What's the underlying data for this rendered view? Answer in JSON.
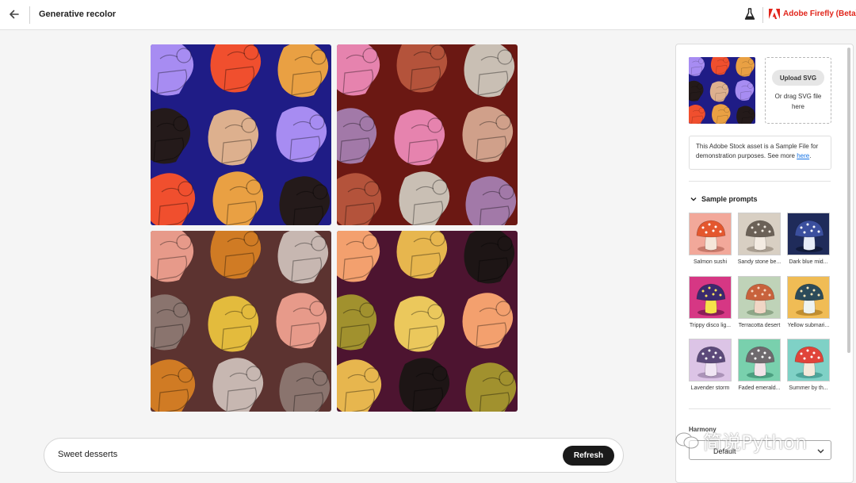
{
  "header": {
    "title": "Generative recolor",
    "back_icon": "arrow-left-icon",
    "labs_icon": "flask-icon",
    "brand_name": "Adobe Firefly (Beta)",
    "brand_color": "#e1251b"
  },
  "tiles": [
    {
      "bg": "#1f1c86",
      "colors": [
        "#a78cf2",
        "#f04f2e",
        "#e9a043",
        "#241a1a",
        "#ddb08e",
        "#a78cf2",
        "#f04f2e",
        "#e9a043",
        "#241a1a"
      ]
    },
    {
      "bg": "#6b1813",
      "colors": [
        "#e683ae",
        "#b4533b",
        "#c9bfb4",
        "#a279a8",
        "#e683ae",
        "#d0a08a",
        "#b4533b",
        "#c9bfb4",
        "#a279a8"
      ]
    },
    {
      "bg": "#5c3330",
      "colors": [
        "#e79a8a",
        "#d07b24",
        "#c7b7b1",
        "#8a746e",
        "#e3bb3d",
        "#e79a8a",
        "#d07b24",
        "#c7b7b1",
        "#8a746e"
      ]
    },
    {
      "bg": "#4d1430",
      "colors": [
        "#f3a06e",
        "#e7b64e",
        "#1d1515",
        "#a1912e",
        "#ebc85c",
        "#f3a06e",
        "#e7b64e",
        "#1d1515",
        "#a1912e"
      ]
    }
  ],
  "prompt": {
    "value": "Sweet desserts",
    "refresh_label": "Refresh"
  },
  "panel": {
    "upload_button": "Upload SVG",
    "upload_hint": "Or drag SVG file here",
    "notice_text": "This Adobe Stock asset is a Sample File for demonstration purposes. See more ",
    "notice_link": "here",
    "notice_end": ".",
    "samples_title": "Sample prompts",
    "samples": [
      {
        "label": "Salmon sushi",
        "bg": "#f2a89a",
        "cap": "#e4572e",
        "spots": "#ffffff",
        "stem": "#f5e6da",
        "shadow": "#c7796b"
      },
      {
        "label": "Sandy stone be...",
        "bg": "#d8cfc3",
        "cap": "#6b6157",
        "spots": "#efe8df",
        "stem": "#f3ebe2",
        "shadow": "#a89d90"
      },
      {
        "label": "Dark blue mid...",
        "bg": "#1f2b5a",
        "cap": "#3b4f9e",
        "spots": "#ffffff",
        "stem": "#e7ecf7",
        "shadow": "#111a3a"
      },
      {
        "label": "Trippy disco lig...",
        "bg": "#d63784",
        "cap": "#3a2a6e",
        "spots": "#ffe35a",
        "stem": "#f6e24a",
        "shadow": "#8a1f58"
      },
      {
        "label": "Terracotta desert",
        "bg": "#bfd3b8",
        "cap": "#c8623c",
        "spots": "#f5d7c2",
        "stem": "#f0d6c5",
        "shadow": "#8ea788"
      },
      {
        "label": "Yellow submari...",
        "bg": "#f0bc55",
        "cap": "#2c4b5a",
        "spots": "#f6e6b8",
        "stem": "#eef3f0",
        "shadow": "#c18e2f"
      },
      {
        "label": "Lavender storm",
        "bg": "#dcc4e6",
        "cap": "#5c4a7a",
        "spots": "#ffffff",
        "stem": "#f1e6f4",
        "shadow": "#ab93b8"
      },
      {
        "label": "Faded emerald...",
        "bg": "#79d0ad",
        "cap": "#6f6a6e",
        "spots": "#ffffff",
        "stem": "#f2e3e8",
        "shadow": "#4b9f80"
      },
      {
        "label": "Summer by th...",
        "bg": "#7fd1c6",
        "cap": "#e0443a",
        "spots": "#ffffff",
        "stem": "#f5e9da",
        "shadow": "#4ea59a"
      }
    ],
    "harmony_label": "Harmony",
    "harmony_value": "Default"
  },
  "watermark": "简说Python"
}
